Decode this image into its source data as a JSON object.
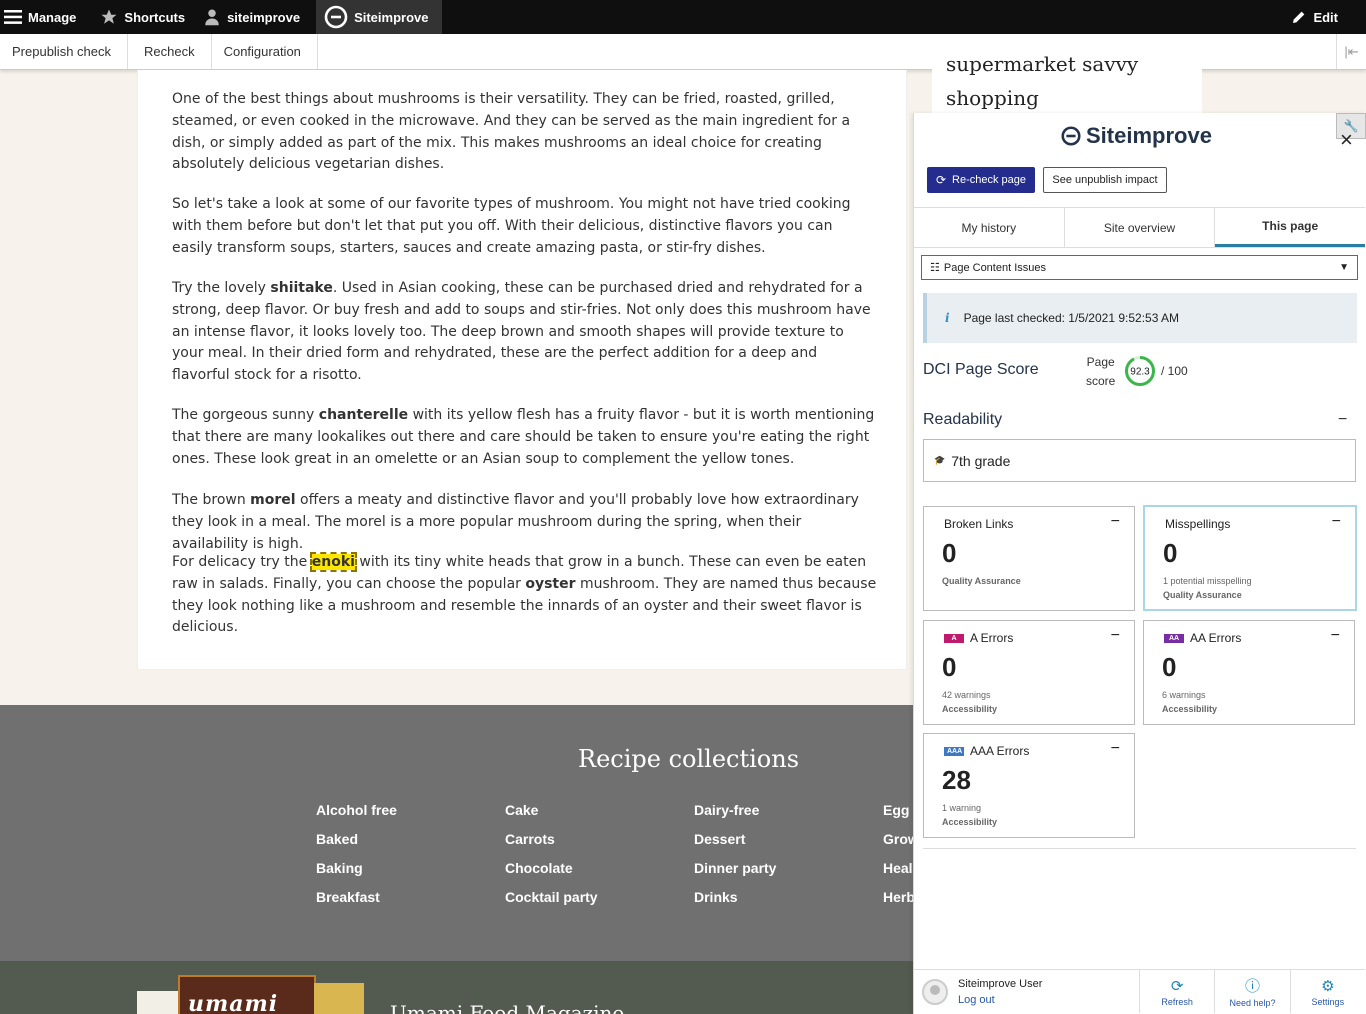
{
  "toolbar": {
    "manage": "Manage",
    "shortcuts": "Shortcuts",
    "user": "siteimprove",
    "siteimprove": "Siteimprove",
    "edit": "Edit"
  },
  "subbar": {
    "prepublish": "Prepublish check",
    "recheck": "Recheck",
    "configuration": "Configuration"
  },
  "article": {
    "p1": "One of the best things about mushrooms is their versatility. They can be fried, roasted, grilled, steamed, or even cooked in the microwave. And they can be served as the main ingredient for a dish, or simply added as part of the mix. This makes mushrooms an ideal choice for creating absolutely delicious vegetarian dishes.",
    "p2": "So let's take a look at some of our favorite types of mushroom. You might not have tried cooking with them before but don't let that put you off. With their delicious, distinctive flavors you can easily transform soups, starters, sauces and create amazing pasta, or stir-fry dishes.",
    "p3a": "Try the lovely ",
    "p3b": "shiitake",
    "p3c": ". Used in Asian cooking, these can be purchased dried and rehydrated for a strong, deep flavor. Or buy fresh and add to soups and stir-fries. Not only does this mushroom have an intense flavor, it looks lovely too. The deep brown and smooth shapes will provide texture to your meal. In their dried form and rehydrated, these are the perfect addition for a deep and flavorful stock for a risotto.",
    "p4a": "The gorgeous sunny ",
    "p4b": "chanterelle",
    "p4c": " with its yellow flesh has a fruity flavor - but it is worth mentioning that there are many lookalikes out there and care should be taken to ensure you're eating the right ones. These look great in an omelette or an Asian soup to complement the yellow tones.",
    "p5a": "The brown ",
    "p5b": "morel",
    "p5c": " offers a meaty and distinctive flavor and you'll probably love how extraordinary they look in a meal. The morel is a more popular mushroom during the spring, when their availability is high.",
    "p6a": "For delicacy try the ",
    "p6b": "enoki",
    "p6c": " with its tiny white heads that grow in a bunch. These can even be eaten raw in salads. Finally, you can choose the popular ",
    "p6d": "oyster",
    "p6e": " mushroom. They are named thus because they look nothing like a mushroom and resemble the innards of an oyster and their sweet flavor is delicious."
  },
  "behind": {
    "line1": "supermarket savvy",
    "line2": "shopping"
  },
  "footer": {
    "title": "Recipe collections",
    "col1": [
      "Alcohol free",
      "Baked",
      "Baking",
      "Breakfast"
    ],
    "col2": [
      "Cake",
      "Carrots",
      "Chocolate",
      "Cocktail party"
    ],
    "col3": [
      "Dairy-free",
      "Dessert",
      "Dinner party",
      "Drinks"
    ],
    "col4": [
      "Egg",
      "Grow",
      "Heal",
      "Herb"
    ],
    "mag_logo": "umami",
    "mag_title": "Umami Food Magazine"
  },
  "panel": {
    "brand": "Siteimprove",
    "recheck_btn": "Re-check page",
    "unpublish_btn": "See unpublish impact",
    "tabs": [
      "My history",
      "Site overview",
      "This page"
    ],
    "select_value": "Page Content Issues",
    "last_checked": "Page last checked: 1/5/2021 9:52:53 AM",
    "dci_title": "DCI Page Score",
    "page_label": "Page",
    "score_label": "score",
    "score": "92.3",
    "score_fraction": 0.923,
    "score_max": "/ 100",
    "readability_title": "Readability",
    "grade": "7th grade",
    "cards": {
      "broken": {
        "title": "Broken Links",
        "num": "0",
        "sub1": "",
        "sub2": "Quality Assurance"
      },
      "misspell": {
        "title": "Misspellings",
        "num": "0",
        "sub1": "1 potential misspelling",
        "sub2": "Quality Assurance"
      },
      "a": {
        "badge": "A",
        "title": "A Errors",
        "num": "0",
        "sub1": "42 warnings",
        "sub2": "Accessibility"
      },
      "aa": {
        "badge": "AA",
        "title": "AA Errors",
        "num": "0",
        "sub1": "6 warnings",
        "sub2": "Accessibility"
      },
      "aaa": {
        "badge": "AAA",
        "title": "AAA Errors",
        "num": "28",
        "sub1": "1 warning",
        "sub2": "Accessibility"
      }
    },
    "user_name": "Siteimprove User",
    "logout": "Log out",
    "refresh": "Refresh",
    "help": "Need help?",
    "settings": "Settings"
  },
  "colors": {
    "accent": "#242d8e",
    "gauge": "#3cb54a",
    "tab_active": "#2a7ea4"
  }
}
